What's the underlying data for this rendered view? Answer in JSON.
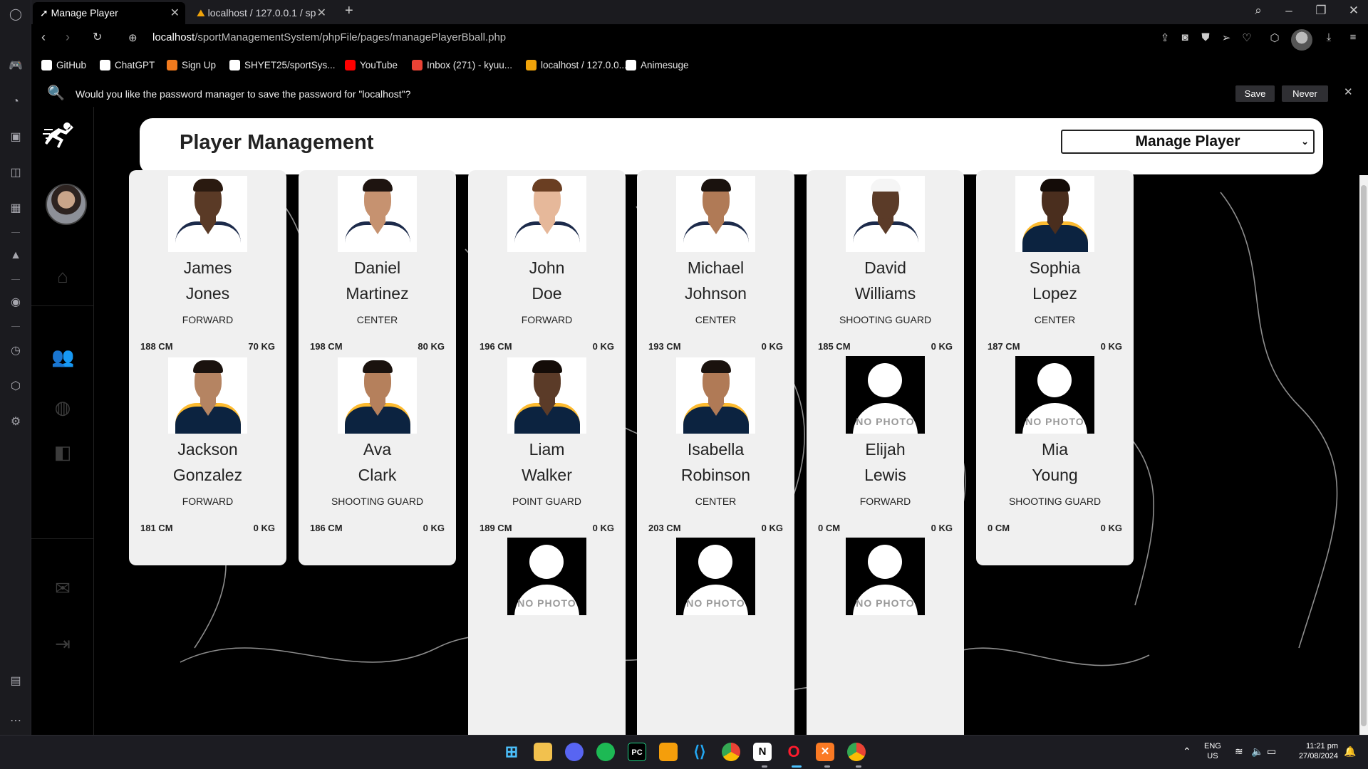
{
  "browser": {
    "tabs": [
      {
        "title": "Manage Player",
        "active": true
      },
      {
        "title": "localhost / 127.0.0.1 / sp",
        "active": false
      }
    ],
    "url_host": "localhost",
    "url_path": "/sportManagementSystem/phpFile/pages/managePlayerBball.php",
    "bookmarks": [
      {
        "label": "GitHub",
        "icon": "github-icon",
        "color": "#ffffff"
      },
      {
        "label": "ChatGPT",
        "icon": "chatgpt-icon",
        "color": "#ffffff"
      },
      {
        "label": "Sign Up",
        "icon": "xampp-icon",
        "color": "#f17a1d"
      },
      {
        "label": "SHYET25/sportSys...",
        "icon": "github-icon",
        "color": "#ffffff"
      },
      {
        "label": "YouTube",
        "icon": "youtube-icon",
        "color": "#ff0000"
      },
      {
        "label": "Inbox (271) - kyuu...",
        "icon": "gmail-icon",
        "color": "#ea4335"
      },
      {
        "label": "localhost / 127.0.0...",
        "icon": "phpmyadmin-icon",
        "color": "#f0a30a"
      },
      {
        "label": "Animesuge",
        "icon": "play-icon",
        "color": "#ffffff"
      }
    ],
    "password_prompt": {
      "message": "Would you like the password manager to save the password for \"localhost\"?",
      "save_label": "Save",
      "never_label": "Never"
    }
  },
  "app": {
    "page_title": "Player Management",
    "manage_select_value": "Manage Player"
  },
  "players": [
    {
      "first": "James",
      "last": "Jones",
      "position": "FORWARD",
      "height": "188 CM",
      "weight": "70 KG",
      "photo": "photo",
      "skin": "#5a3a26",
      "hair": "#2a1a10",
      "jersey": "#ffffff",
      "trim": "#1c2a4a"
    },
    {
      "first": "Daniel",
      "last": "Martinez",
      "position": "CENTER",
      "height": "198 CM",
      "weight": "80 KG",
      "photo": "photo",
      "skin": "#c69270",
      "hair": "#1e1410",
      "jersey": "#ffffff",
      "trim": "#1c2a4a"
    },
    {
      "first": "John",
      "last": "Doe",
      "position": "FORWARD",
      "height": "196 CM",
      "weight": "0 KG",
      "photo": "photo",
      "skin": "#e6b89a",
      "hair": "#6a3e22",
      "jersey": "#ffffff",
      "trim": "#1c2a4a"
    },
    {
      "first": "Michael",
      "last": "Johnson",
      "position": "CENTER",
      "height": "193 CM",
      "weight": "0 KG",
      "photo": "photo",
      "skin": "#b07a56",
      "hair": "#1a120e",
      "jersey": "#ffffff",
      "trim": "#1c2a4a"
    },
    {
      "first": "David",
      "last": "Williams",
      "position": "SHOOTING GUARD",
      "height": "185 CM",
      "weight": "0 KG",
      "photo": "photo",
      "skin": "#5b3b28",
      "hair": "#f5f5f5",
      "jersey": "#ffffff",
      "trim": "#1c2a4a"
    },
    {
      "first": "Sophia",
      "last": "Lopez",
      "position": "CENTER",
      "height": "187 CM",
      "weight": "0 KG",
      "photo": "photo",
      "skin": "#4a2e1e",
      "hair": "#140c08",
      "jersey": "#0c2340",
      "trim": "#fdbb30"
    },
    {
      "first": "Jackson",
      "last": "Gonzalez",
      "position": "FORWARD",
      "height": "181 CM",
      "weight": "0 KG",
      "photo": "photo",
      "skin": "#b58462",
      "hair": "#1a120e",
      "jersey": "#0c2340",
      "trim": "#fdbb30"
    },
    {
      "first": "Ava",
      "last": "Clark",
      "position": "SHOOTING GUARD",
      "height": "186 CM",
      "weight": "0 KG",
      "photo": "photo",
      "skin": "#b5805c",
      "hair": "#1a120e",
      "jersey": "#0c2340",
      "trim": "#fdbb30"
    },
    {
      "first": "Liam",
      "last": "Walker",
      "position": "POINT GUARD",
      "height": "189 CM",
      "weight": "0 KG",
      "photo": "photo",
      "skin": "#5b3b28",
      "hair": "#140c08",
      "jersey": "#0c2340",
      "trim": "#fdbb30"
    },
    {
      "first": "Isabella",
      "last": "Robinson",
      "position": "CENTER",
      "height": "203 CM",
      "weight": "0 KG",
      "photo": "photo",
      "skin": "#b07a56",
      "hair": "#1a120e",
      "jersey": "#0c2340",
      "trim": "#fdbb30"
    },
    {
      "first": "Elijah",
      "last": "Lewis",
      "position": "FORWARD",
      "height": "0 CM",
      "weight": "0 KG",
      "photo": "none"
    },
    {
      "first": "Mia",
      "last": "Young",
      "position": "SHOOTING GUARD",
      "height": "0 CM",
      "weight": "0 KG",
      "photo": "none"
    },
    {
      "photo": "none"
    },
    {
      "photo": "none"
    },
    {
      "photo": "none"
    }
  ],
  "no_photo_label": "NO PHOTO",
  "taskbar": {
    "lang_line1": "ENG",
    "lang_line2": "US",
    "time": "11:21 pm",
    "date": "27/08/2024"
  }
}
